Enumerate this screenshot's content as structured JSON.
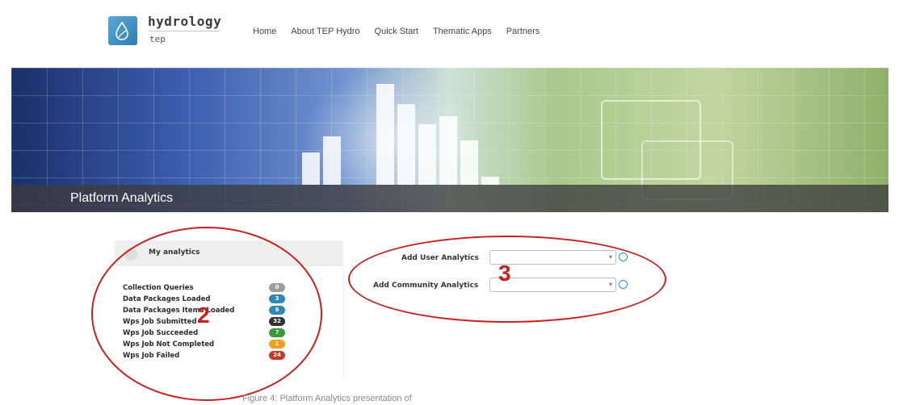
{
  "logo": {
    "name": "hydrology",
    "sub": "tep",
    "icon": "droplet-leaf-icon"
  },
  "nav": [
    "Home",
    "About TEP Hydro",
    "Quick Start",
    "Thematic Apps",
    "Partners"
  ],
  "banner": {
    "title": "Platform Analytics"
  },
  "my_analytics": {
    "title": "My analytics",
    "stats": [
      {
        "label": "Collection Queries",
        "value": "0",
        "color": "#9e9e9e"
      },
      {
        "label": "Data Packages Loaded",
        "value": "3",
        "color": "#2f86b8"
      },
      {
        "label": "Data Packages Items Loaded",
        "value": "6",
        "color": "#2f86b8"
      },
      {
        "label": "Wps Job Submitted",
        "value": "32",
        "color": "#333333"
      },
      {
        "label": "Wps Job Succeeded",
        "value": "7",
        "color": "#3a9a3a"
      },
      {
        "label": "Wps Job Not Completed",
        "value": "1",
        "color": "#f0a020"
      },
      {
        "label": "Wps Job Failed",
        "value": "24",
        "color": "#c0392b"
      }
    ]
  },
  "add_analytics": {
    "user_label": "Add User Analytics",
    "community_label": "Add Community Analytics",
    "user_value": "",
    "community_value": "",
    "add_icon": "add-circle-icon"
  },
  "annotations": {
    "left": "2",
    "right": "3"
  },
  "caption": "Figure 4: Platform Analytics presentation of"
}
